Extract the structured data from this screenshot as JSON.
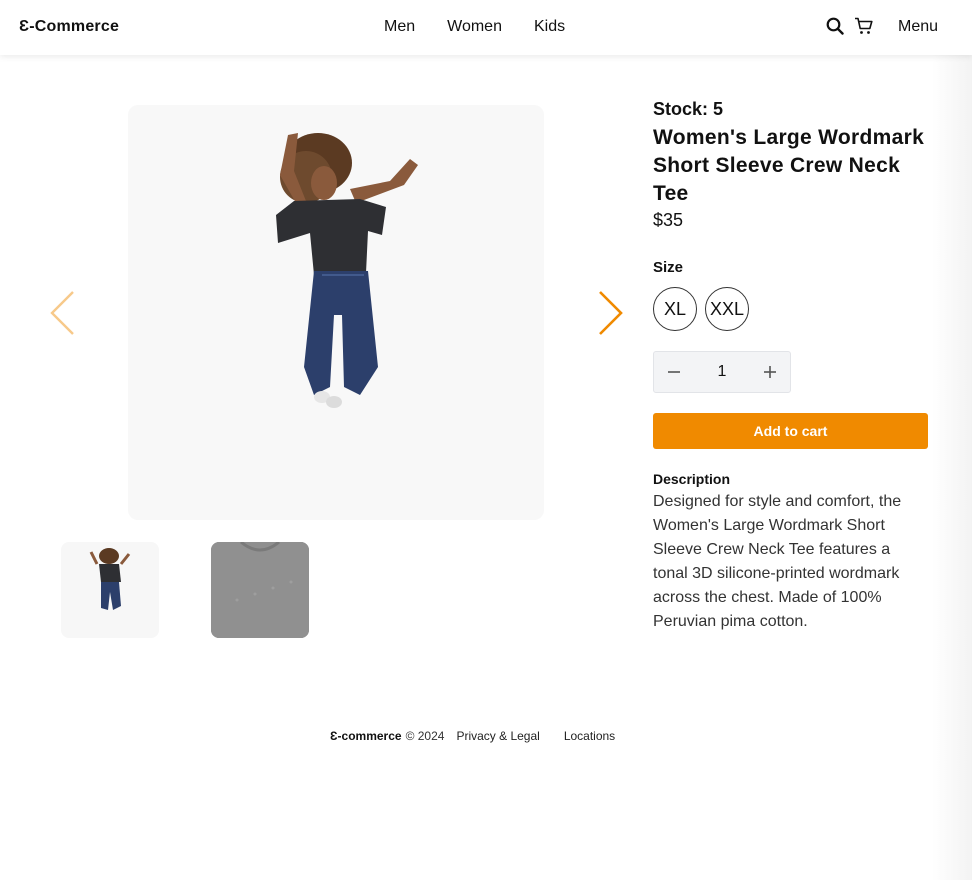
{
  "header": {
    "logo": "Ɛ-Commerce",
    "nav": [
      "Men",
      "Women",
      "Kids"
    ],
    "menu_label": "Menu",
    "icons": [
      "search-icon",
      "cart-icon"
    ]
  },
  "gallery": {
    "prev_icon": "chevron-left-icon",
    "next_icon": "chevron-right-icon",
    "accent": "#f08a00"
  },
  "product": {
    "stock": "Stock: 5",
    "title": "Women's Large Wordmark Short Sleeve Crew Neck Tee",
    "price": "$35",
    "size_label": "Size",
    "sizes": [
      "XL",
      "XXL"
    ],
    "quantity": "1",
    "add_to_cart": "Add to cart",
    "description_label": "Description",
    "description": "Designed for style and comfort, the Women's Large Wordmark Short Sleeve Crew Neck Tee features a tonal 3D silicone-printed wordmark across the chest. Made of 100% Peruvian pima cotton."
  },
  "footer": {
    "logo": "Ɛ-commerce",
    "copyright": "© 2024",
    "links": [
      "Privacy & Legal",
      "Locations"
    ]
  }
}
